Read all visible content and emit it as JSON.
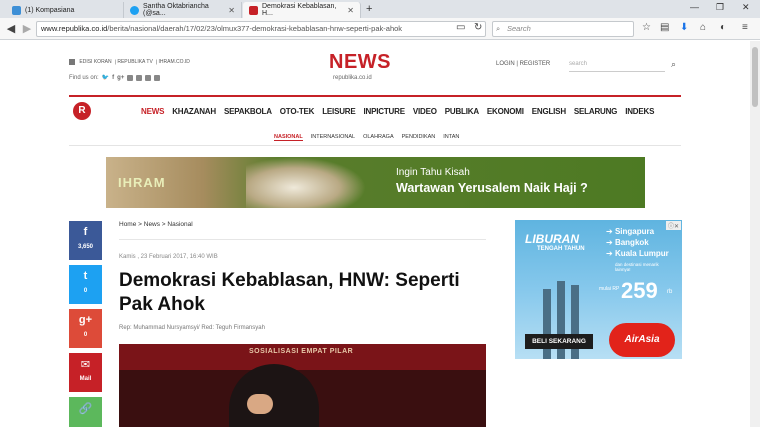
{
  "browser": {
    "tabs": [
      {
        "title": "(1) Kompasiana",
        "favicon_color": "#3d8fd6"
      },
      {
        "title": "Santha Oktabriancha (@sa...",
        "favicon_color": "#1da1f2"
      },
      {
        "title": "Demokrasi Kebablasan, H...",
        "favicon_color": "#c62127"
      }
    ],
    "new_tab": "+",
    "url_host": "www.republika.co.id",
    "url_path": "/berita/nasional/daerah/17/02/23/olmux377-demokrasi-kebablasan-hnw-seperti-pak-ahok",
    "search_placeholder": "Search"
  },
  "header": {
    "top_links": [
      "EDISI KORAN",
      "REPUBLIKA TV",
      "IHRAM.CO.ID"
    ],
    "find_us": "Find us on:",
    "logo": "NEWS",
    "logo_sub": "republika.co.id",
    "login": "LOGIN",
    "register": "REGISTER",
    "search_placeholder": "search"
  },
  "main_nav": [
    "NEWS",
    "KHAZANAH",
    "SEPAKBOLA",
    "OTO-TEK",
    "LEISURE",
    "INPICTURE",
    "VIDEO",
    "PUBLIKA",
    "EKONOMI",
    "ENGLISH",
    "SELARUNG",
    "INDEKS"
  ],
  "sub_nav": [
    "NASIONAL",
    "INTERNASIONAL",
    "OLAHRAGA",
    "PENDIDIKAN",
    "INTAN"
  ],
  "banner": {
    "logo": "IHRAM",
    "line1": "Ingin Tahu Kisah",
    "line2": "Wartawan Yerusalem Naik Haji ?"
  },
  "social": [
    {
      "icon": "f",
      "count": "3,650",
      "color": "#3b5998"
    },
    {
      "icon": "t",
      "count": "0",
      "color": "#1da1f2"
    },
    {
      "icon": "g+",
      "count": "0",
      "color": "#dd4b39"
    },
    {
      "icon": "✉",
      "count": "Mail",
      "color": "#c62127"
    },
    {
      "icon": "🔗",
      "count": "",
      "color": "#5cb85c"
    }
  ],
  "article": {
    "breadcrumb": "Home > News > Nasional",
    "date": "Kamis , 23 Februari 2017, 16:40 WIB",
    "title": "Demokrasi Kebablasan, HNW: Seperti Pak Ahok",
    "reporter": "Rep: Muhammad Nursyamsyi/ Red: Teguh Firmansyah",
    "photo_text": "SOSIALISASI EMPAT PILAR"
  },
  "ad": {
    "title": "LIBURAN",
    "subtitle": "TENGAH TAHUN",
    "destinations": [
      "Singapura",
      "Bangkok",
      "Kuala Lumpur"
    ],
    "note": "dan destinasi menarik lainnya!",
    "price_label": "mulai RP",
    "price": "259",
    "price_unit": "rb",
    "button": "BELI SEKARANG",
    "brand": "AirAsia"
  }
}
